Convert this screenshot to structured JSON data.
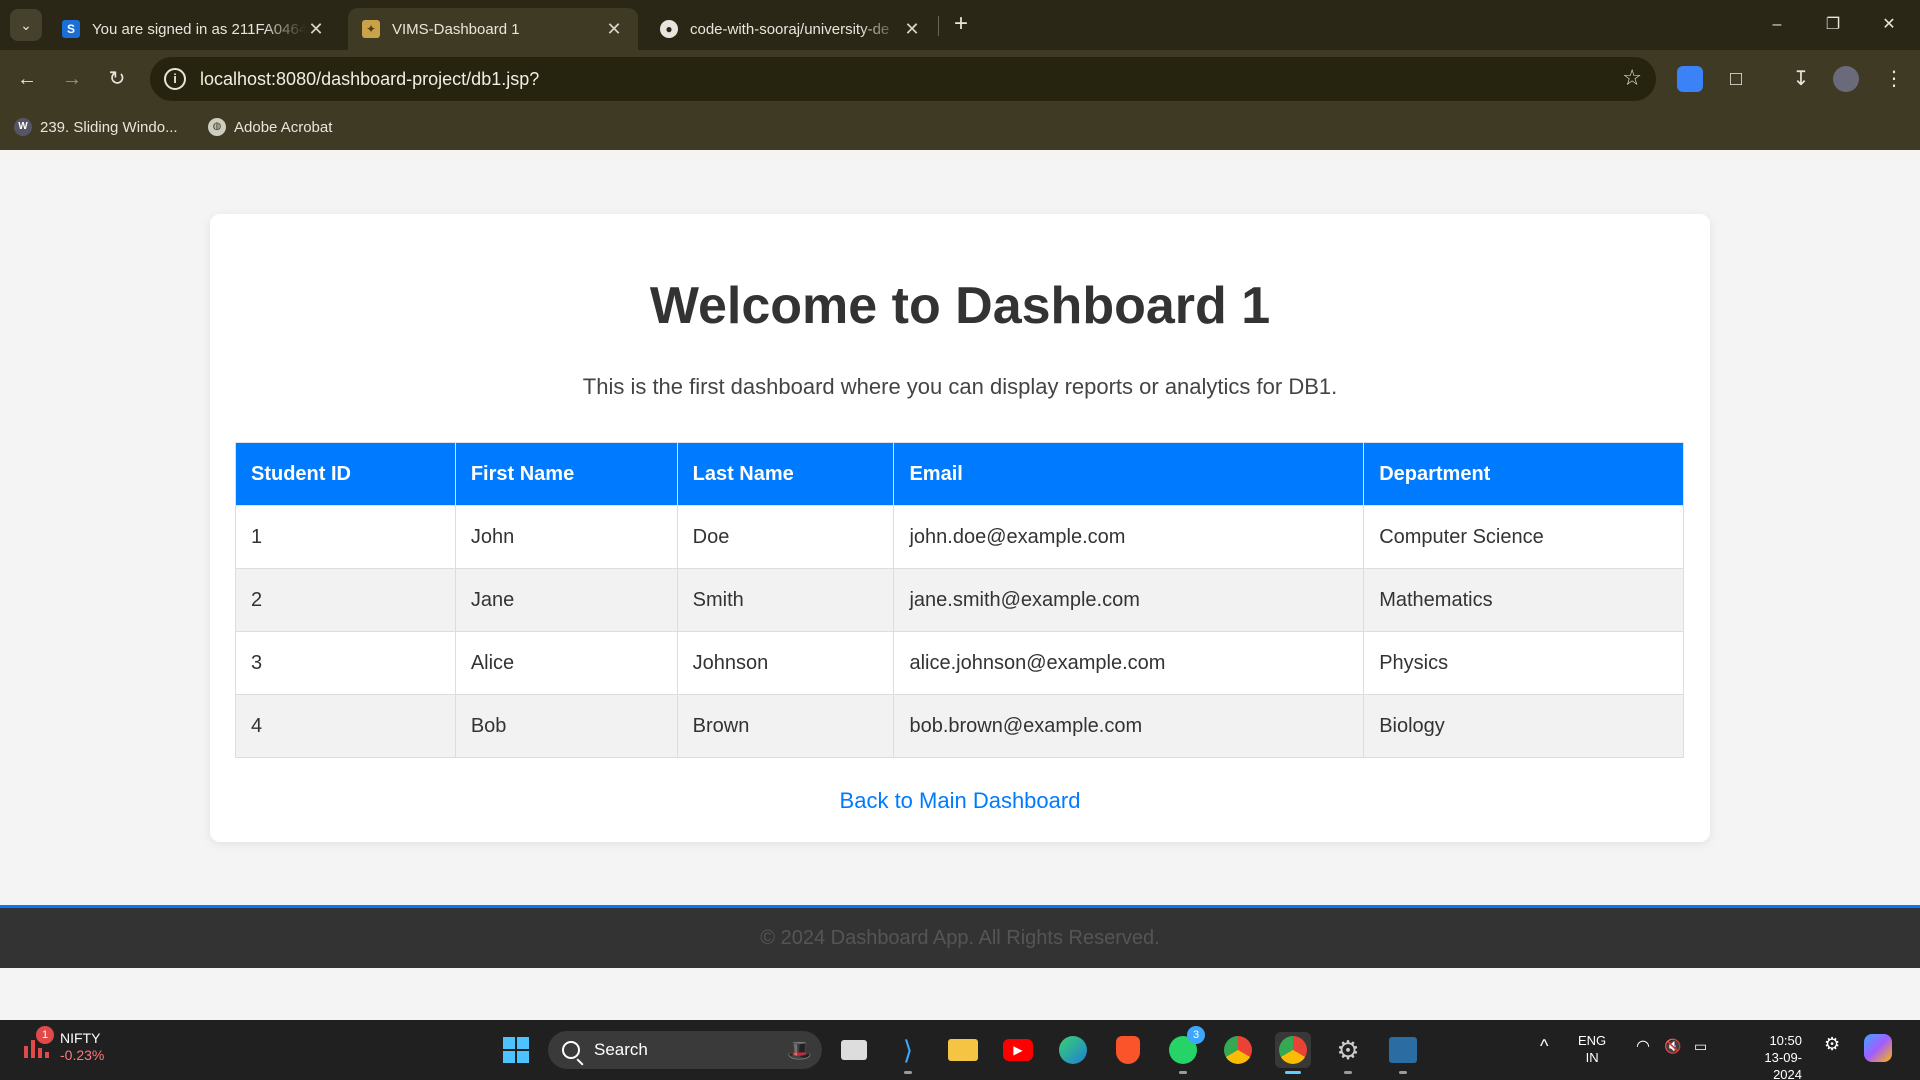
{
  "browser": {
    "tabs": [
      {
        "title": "You are signed in as 211FA0464",
        "favicon": "s-icon"
      },
      {
        "title": "VIMS-Dashboard 1",
        "favicon": "vims-icon",
        "active": true
      },
      {
        "title": "code-with-sooraj/university-de",
        "favicon": "github-icon"
      }
    ],
    "url": "localhost:8080/dashboard-project/db1.jsp?",
    "bookmarks": [
      {
        "label": "239. Sliding Windo...",
        "icon": "w-icon"
      },
      {
        "label": "Adobe Acrobat",
        "icon": "globe-icon"
      }
    ]
  },
  "page": {
    "heading": "Welcome to Dashboard 1",
    "subtitle": "This is the first dashboard where you can display reports or analytics for DB1.",
    "table": {
      "headers": [
        "Student ID",
        "First Name",
        "Last Name",
        "Email",
        "Department"
      ],
      "rows": [
        [
          "1",
          "John",
          "Doe",
          "john.doe@example.com",
          "Computer Science"
        ],
        [
          "2",
          "Jane",
          "Smith",
          "jane.smith@example.com",
          "Mathematics"
        ],
        [
          "3",
          "Alice",
          "Johnson",
          "alice.johnson@example.com",
          "Physics"
        ],
        [
          "4",
          "Bob",
          "Brown",
          "bob.brown@example.com",
          "Biology"
        ]
      ]
    },
    "back_link": "Back to Main Dashboard",
    "footer": "© 2024 Dashboard App. All Rights Reserved.",
    "colors": {
      "accent": "#007bff",
      "footer_bg": "#333333"
    }
  },
  "taskbar": {
    "widget": {
      "name": "NIFTY",
      "change": "-0.23%",
      "badge": "1"
    },
    "search_label": "Search",
    "whatsapp_badge": "3",
    "lang": {
      "line1": "ENG",
      "line2": "IN"
    },
    "clock": {
      "time": "10:50",
      "date": "13-09-2024"
    }
  }
}
